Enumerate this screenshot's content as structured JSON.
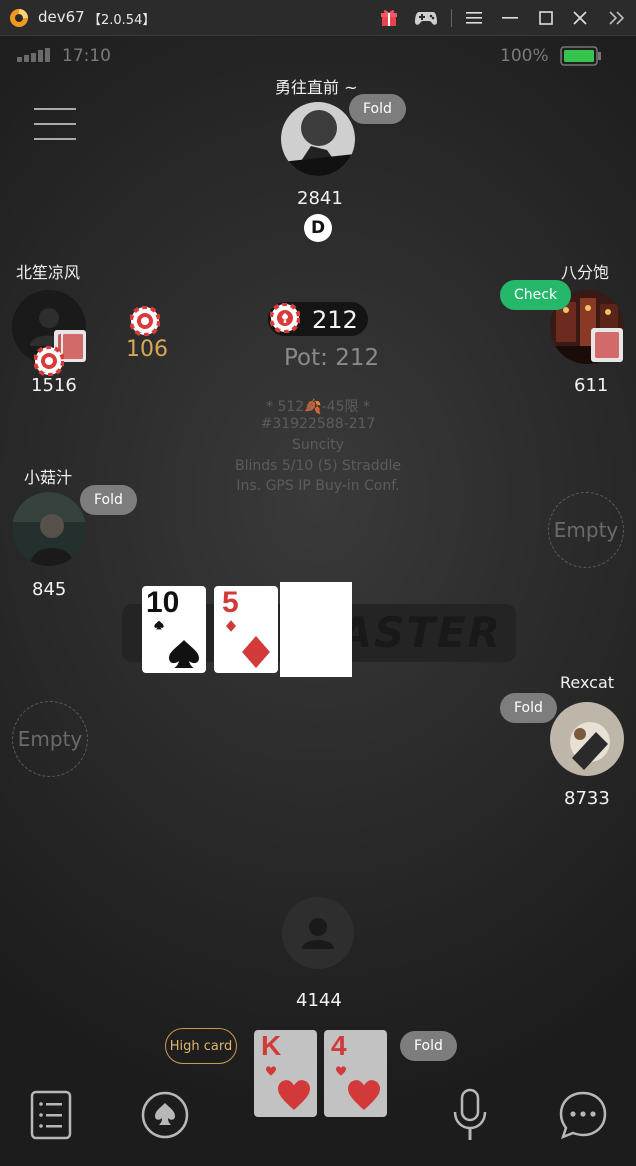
{
  "window": {
    "app_name": "dev67",
    "version": "【2.0.54】",
    "icons": [
      "app-logo-icon",
      "gift-icon",
      "gamepad-icon",
      "menu-icon",
      "minimize-icon",
      "maximize-icon",
      "close-icon",
      "collapse-icon"
    ]
  },
  "status_bar": {
    "time": "17:10",
    "battery": "100%"
  },
  "players": {
    "top": {
      "name": "勇往直前 ~",
      "stack": "2841",
      "action": "Fold",
      "dealer": "D"
    },
    "left_upper": {
      "name": "北笙凉风",
      "stack": "1516",
      "bet": "106"
    },
    "right_upper": {
      "name": "八分饱",
      "stack": "611",
      "action": "Check"
    },
    "left_middle": {
      "name": "小菇汁",
      "stack": "845",
      "action": "Fold"
    },
    "right_middle": {
      "label": "Empty"
    },
    "left_lower": {
      "label": "Empty"
    },
    "right_lower": {
      "name": "Rexcat",
      "stack": "8733",
      "action": "Fold"
    },
    "hero": {
      "stack": "4144",
      "action": "Fold",
      "hand_type": "High card"
    }
  },
  "pot": {
    "current_bet": "212",
    "label": "Pot: 212"
  },
  "table_info": {
    "line1": "* 512🍂-45限 *",
    "line2": "#31922588-217",
    "line3": "Suncity",
    "line4": "Blinds 5/10 (5) Straddle",
    "line5": "Ins. GPS IP Buy-in Conf."
  },
  "watermark": "ASTER",
  "board": [
    {
      "rank": "10",
      "suit": "spade",
      "color": "#111111"
    },
    {
      "rank": "5",
      "suit": "diamond",
      "color": "#d23a3a"
    }
  ],
  "hero_cards": [
    {
      "rank": "K",
      "suit": "heart",
      "color": "#d23a3a"
    },
    {
      "rank": "4",
      "suit": "heart",
      "color": "#d23a3a"
    }
  ],
  "bottom_bar": {
    "icons": [
      "list-icon",
      "spade-icon",
      "microphone-icon",
      "chat-icon"
    ]
  },
  "colors": {
    "accent_gold": "#d7a756",
    "check_green": "#25b86a",
    "heart_red": "#d23a3a"
  }
}
